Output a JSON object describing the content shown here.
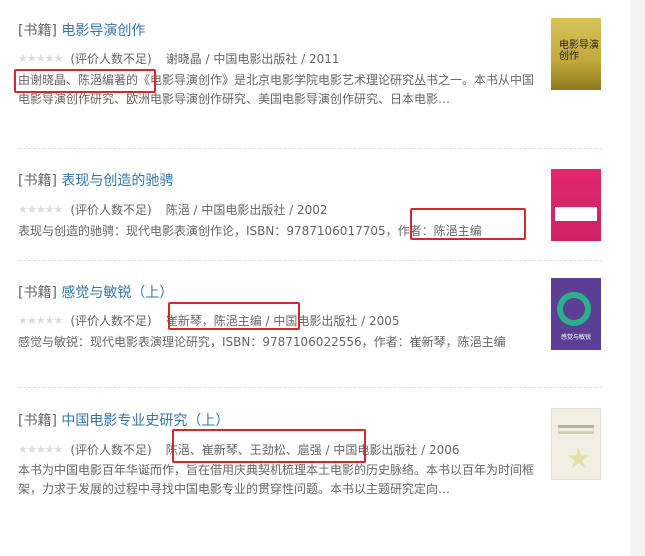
{
  "books": [
    {
      "tag": "[书籍]",
      "title": "电影导演创作",
      "stars": "★★★★★",
      "rating": "(评价人数不足)",
      "meta": "谢晓晶 / 中国电影出版社 / 2011",
      "desc": "由谢晓晶、陈浥编著的《电影导演创作》是北京电影学院电影艺术理论研究丛书之一。本书从中国电影导演创作研究、欧洲电影导演创作研究、美国电影导演创作研究、日本电影…",
      "cover_text": "电影导演创作"
    },
    {
      "tag": "[书籍]",
      "title": "表现与创造的驰骋",
      "stars": "★★★★★",
      "rating": "(评价人数不足)",
      "meta": "陈浥 / 中国电影出版社 / 2002",
      "desc": "表现与创造的驰骋：现代电影表演创作论，ISBN：9787106017705，作者：陈浥主编"
    },
    {
      "tag": "[书籍]",
      "title": "感觉与敏锐（上）",
      "stars": "★★★★★",
      "rating": "(评价人数不足)",
      "meta": "崔新琴，陈浥主编 / 中国电影出版社 / 2005",
      "desc": "感觉与敏锐：现代电影表演理论研究，ISBN：9787106022556，作者：崔新琴，陈浥主编",
      "cover_text": "感觉与敏锐"
    },
    {
      "tag": "[书籍]",
      "title": "中国电影专业史研究（上）",
      "stars": "★★★★★",
      "rating": "(评价人数不足)",
      "meta": "陈浥、崔新琴、王劲松、扈强 / 中国电影出版社 / 2006",
      "desc": "本书为中国电影百年华诞而作，旨在借用庆典契机梳理本土电影的历史脉络。本书以百年为时间框架，力求于发展的过程中寻找中国电影专业的贯穿性问题。本书以主题研究定向…"
    }
  ],
  "colors": {
    "link": "#3377aa",
    "highlight": "#d6262e",
    "muted": "#666666"
  }
}
